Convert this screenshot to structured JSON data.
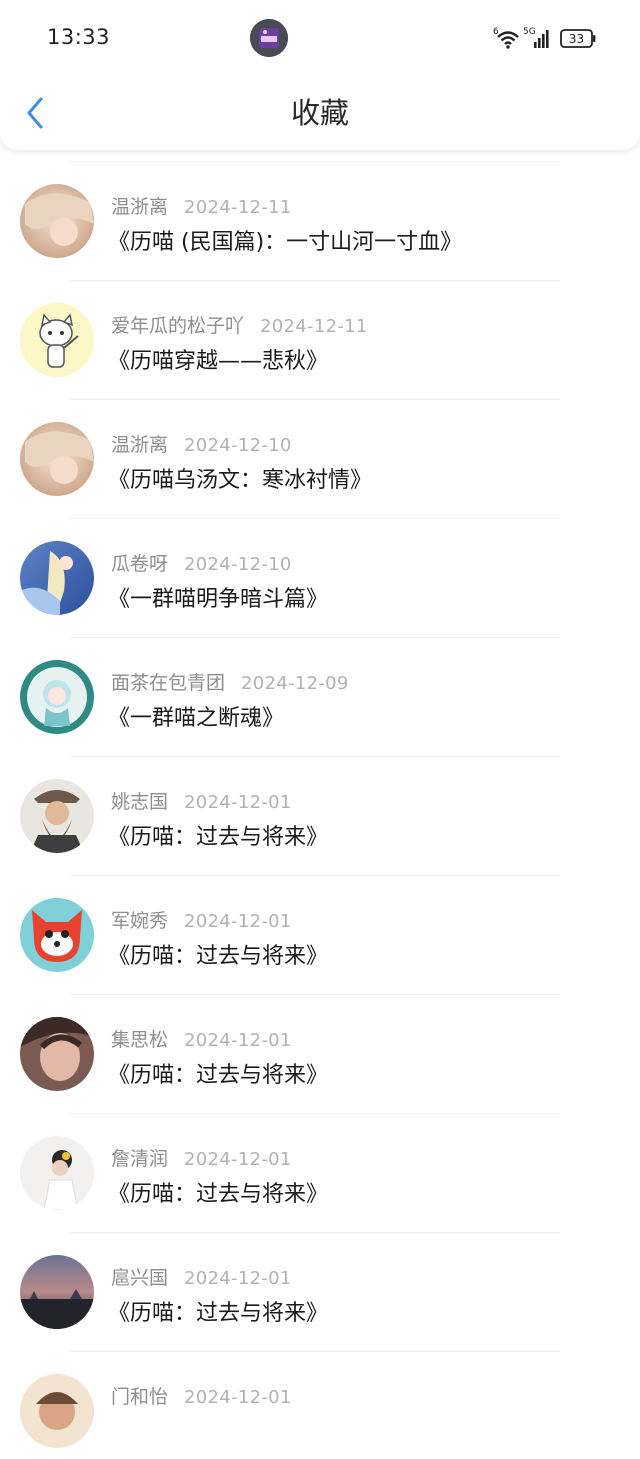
{
  "status_bar": {
    "time": "13:33",
    "signal_label": "5G",
    "wifi_label": "6",
    "battery": "33"
  },
  "nav": {
    "title": "收藏",
    "back_icon": "chevron-left-icon"
  },
  "colors": {
    "accent": "#3a8ee6",
    "author_text": "#8e8e8e",
    "date_text": "#b2b2b2",
    "title_text": "#1a1a1a"
  },
  "favorites": [
    {
      "author": "温浙离",
      "date": "2024-12-11",
      "title": "《历喵 (民国篇)：一寸山河一寸血》"
    },
    {
      "author": "爱年瓜的松子吖",
      "date": "2024-12-11",
      "title": "《历喵穿越——悲秋》"
    },
    {
      "author": "温浙离",
      "date": "2024-12-10",
      "title": "《历喵乌汤文：寒冰衬情》"
    },
    {
      "author": "瓜卷呀",
      "date": "2024-12-10",
      "title": "《一群喵明争暗斗篇》"
    },
    {
      "author": "面茶在包青团",
      "date": "2024-12-09",
      "title": "《一群喵之断魂》"
    },
    {
      "author": "姚志国",
      "date": "2024-12-01",
      "title": "《历喵：过去与将来》"
    },
    {
      "author": "军婉秀",
      "date": "2024-12-01",
      "title": "《历喵：过去与将来》"
    },
    {
      "author": "集思松",
      "date": "2024-12-01",
      "title": "《历喵：过去与将来》"
    },
    {
      "author": "詹清润",
      "date": "2024-12-01",
      "title": "《历喵：过去与将来》"
    },
    {
      "author": "扈兴国",
      "date": "2024-12-01",
      "title": "《历喵：过去与将来》"
    },
    {
      "author": "门和怡",
      "date": "2024-12-01",
      "title": ""
    }
  ]
}
